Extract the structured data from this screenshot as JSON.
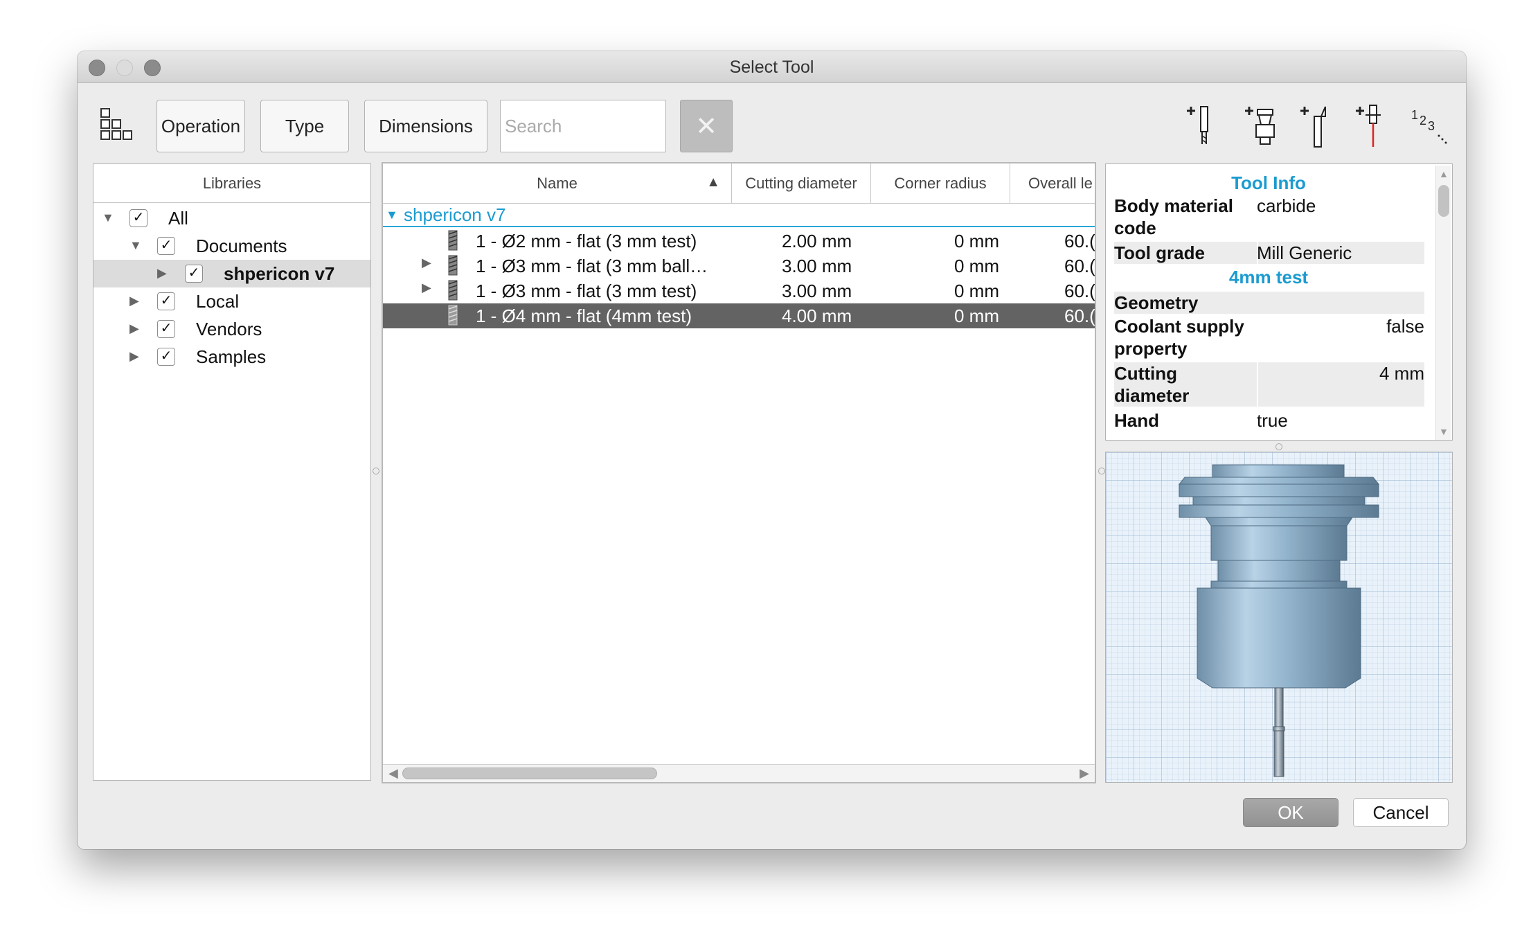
{
  "window": {
    "title": "Select Tool"
  },
  "toolbar": {
    "operation_label": "Operation",
    "type_label": "Type",
    "dimensions_label": "Dimensions",
    "search_placeholder": "Search",
    "clear_label": "✕",
    "icons": [
      "layout-grid-icon",
      "add-mill-tool-icon",
      "add-holder-icon",
      "add-turning-tool-icon",
      "add-probe-icon",
      "numbering-icon"
    ]
  },
  "libraries": {
    "header": "Libraries",
    "items": [
      {
        "label": "All",
        "checked": true,
        "expanded": true
      },
      {
        "label": "Documents",
        "checked": true,
        "expanded": true
      },
      {
        "label": "shpericon v7",
        "checked": true,
        "expanded": false,
        "selected": true
      },
      {
        "label": "Local",
        "checked": true,
        "expanded": false
      },
      {
        "label": "Vendors",
        "checked": true,
        "expanded": false
      },
      {
        "label": "Samples",
        "checked": true,
        "expanded": false
      }
    ]
  },
  "table": {
    "columns": [
      "Name",
      "Cutting diameter",
      "Corner radius",
      "Overall le"
    ],
    "sort_indicator": "▲",
    "group": "shpericon v7",
    "rows": [
      {
        "name": "1 - Ø2 mm - flat (3 mm test)",
        "cutting_diameter": "2.00 mm",
        "corner_radius": "0 mm",
        "overall": "60.(",
        "expandable": false
      },
      {
        "name": "1 - Ø3 mm - flat (3 mm ball…",
        "cutting_diameter": "3.00 mm",
        "corner_radius": "0 mm",
        "overall": "60.(",
        "expandable": true
      },
      {
        "name": "1 - Ø3 mm - flat (3 mm test)",
        "cutting_diameter": "3.00 mm",
        "corner_radius": "0 mm",
        "overall": "60.(",
        "expandable": true
      },
      {
        "name": "1 - Ø4 mm - flat (4mm test)",
        "cutting_diameter": "4.00 mm",
        "corner_radius": "0 mm",
        "overall": "60.(",
        "expandable": false,
        "selected": true
      }
    ]
  },
  "info": {
    "section_title": "Tool Info",
    "body_material_key": "Body material code",
    "body_material_val": "carbide",
    "tool_grade_key": "Tool grade",
    "tool_grade_val": "Mill Generic",
    "subsection": "4mm test",
    "geometry_key": "Geometry",
    "coolant_key": "Coolant supply property",
    "coolant_val": "false",
    "cutting_key": "Cutting diameter",
    "cutting_val": "4 mm",
    "hand_key": "Hand",
    "hand_val": "true"
  },
  "buttons": {
    "ok": "OK",
    "cancel": "Cancel"
  },
  "colors": {
    "accent": "#1b9bd0",
    "selection": "#636363",
    "tool_body": "#8fb3cf"
  }
}
